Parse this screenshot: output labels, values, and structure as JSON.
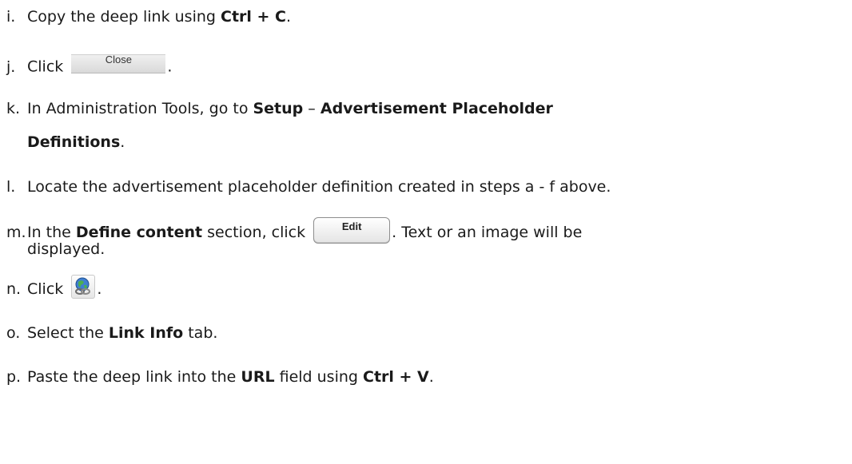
{
  "steps": [
    {
      "letter": "i.",
      "parts": [
        "Copy the deep link using ",
        "Ctrl + C",
        "."
      ]
    },
    {
      "letter": "j.",
      "before": "Click ",
      "button": "Close",
      "after": "."
    },
    {
      "letter": "k.",
      "line1": [
        "In Administration Tools, go to ",
        "Setup",
        " – ",
        "Advertisement Placeholder"
      ],
      "line2": [
        "Definitions",
        "."
      ]
    },
    {
      "letter": "l.",
      "text": "Locate the advertisement placeholder definition created in steps a - f above."
    },
    {
      "letter": "m.",
      "line1": [
        "In the ",
        "Define content",
        " section, click ",
        ". Text or an image will be"
      ],
      "button": "Edit",
      "line2": "displayed."
    },
    {
      "letter": "n.",
      "before": "Click ",
      "icon": "link-globe-icon",
      "after": "."
    },
    {
      "letter": "o.",
      "parts": [
        "Select the ",
        "Link Info",
        " tab."
      ]
    },
    {
      "letter": "p.",
      "parts": [
        "Paste the deep link into the ",
        "URL",
        " field using ",
        "Ctrl + V",
        "."
      ]
    }
  ]
}
